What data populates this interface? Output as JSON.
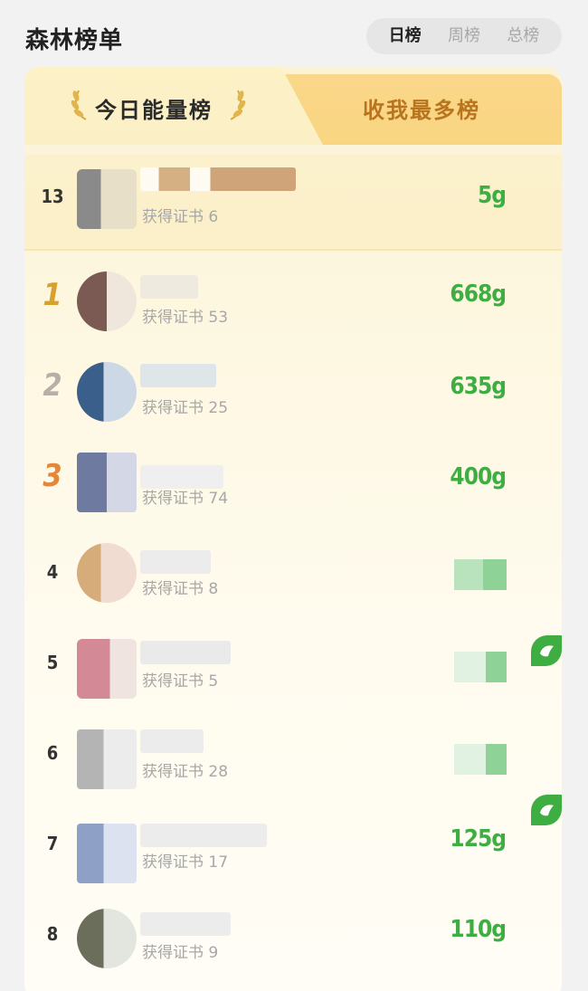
{
  "header": {
    "title": "森林榜单",
    "periods": [
      "日榜",
      "周榜",
      "总榜"
    ],
    "active_period": "日榜"
  },
  "tabs": {
    "active": "今日能量榜",
    "inactive": "收我最多榜"
  },
  "my_row": {
    "rank": "13",
    "cert": "获得证书 6",
    "energy": "5g"
  },
  "rows": [
    {
      "rank": "1",
      "cert": "获得证书 53",
      "energy": "668g"
    },
    {
      "rank": "2",
      "cert": "获得证书 25",
      "energy": "635g"
    },
    {
      "rank": "3",
      "cert": "获得证书 74",
      "energy": "400g"
    },
    {
      "rank": "4",
      "cert": "获得证书 8",
      "energy": ""
    },
    {
      "rank": "5",
      "cert": "获得证书 5",
      "energy": ""
    },
    {
      "rank": "6",
      "cert": "获得证书 28",
      "energy": ""
    },
    {
      "rank": "7",
      "cert": "获得证书 17",
      "energy": "125g"
    },
    {
      "rank": "8",
      "cert": "获得证书 9",
      "energy": "110g"
    }
  ],
  "colors": {
    "energy_green": "#3fae42",
    "gold": "#d7a12b",
    "silver": "#b7b0a6",
    "bronze": "#e4873a",
    "inactive_tab": "#b8741e"
  },
  "icons": {
    "laurel": "laurel-icon",
    "steal_badge": "hand-icon"
  }
}
